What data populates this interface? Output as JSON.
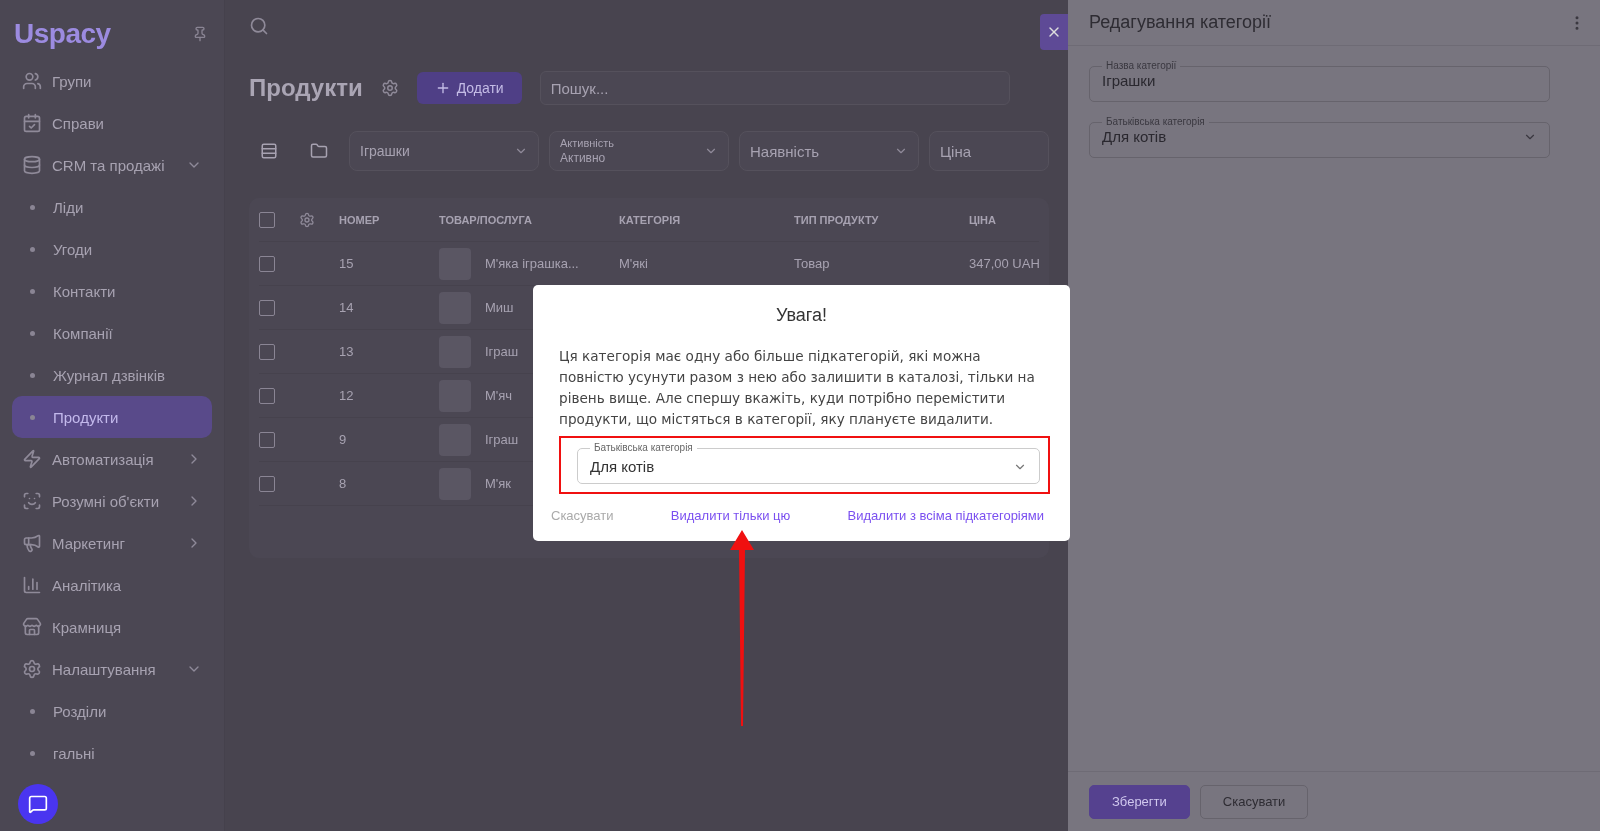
{
  "sidebar": {
    "logo": "Uspacy",
    "items": [
      {
        "kind": "section",
        "label": "Групи",
        "selected": false
      },
      {
        "kind": "section",
        "label": "Справи",
        "selected": false
      },
      {
        "kind": "group",
        "label": "CRM та продажі",
        "expanded": true,
        "selected": false
      },
      {
        "kind": "sub",
        "label": "Ліди",
        "selected": false
      },
      {
        "kind": "sub",
        "label": "Угоди",
        "selected": false
      },
      {
        "kind": "sub",
        "label": "Контакти",
        "selected": false
      },
      {
        "kind": "sub",
        "label": "Компанії",
        "selected": false
      },
      {
        "kind": "sub",
        "label": "Журнал дзвінків",
        "selected": false
      },
      {
        "kind": "sub",
        "label": "Продукти",
        "selected": true
      },
      {
        "kind": "group",
        "label": "Автоматизація",
        "expanded": false,
        "selected": false
      },
      {
        "kind": "group",
        "label": "Розумні об'єкти",
        "expanded": false,
        "selected": false
      },
      {
        "kind": "group",
        "label": "Маркетинг",
        "expanded": false,
        "selected": false
      },
      {
        "kind": "section",
        "label": "Аналітика",
        "selected": false
      },
      {
        "kind": "section",
        "label": "Крамниця",
        "selected": false
      },
      {
        "kind": "group",
        "label": "Налаштування",
        "expanded": true,
        "selected": false
      },
      {
        "kind": "sub",
        "label": "Розділи",
        "selected": false
      },
      {
        "kind": "sub",
        "label": "гальні",
        "selected": false
      }
    ]
  },
  "main": {
    "title": "Продукти",
    "add_button": "Додати",
    "search": {
      "placeholder": "Пошук..."
    },
    "filters": [
      {
        "kind": "select",
        "value": "Іграшки"
      },
      {
        "kind": "select",
        "label": "Активність",
        "value": "Активно"
      },
      {
        "kind": "select",
        "placeholder": "Наявність"
      },
      {
        "kind": "field",
        "placeholder": "Ціна"
      }
    ],
    "table": {
      "select_all_checked": false,
      "columns": [
        "НОМЕР",
        "ТОВАР/ПОСЛУГА",
        "КАТЕГОРІЯ",
        "ТИП ПРОДУКТУ",
        "ЦІНА"
      ],
      "rows": [
        {
          "checked": false,
          "number": "15",
          "name": "М'яка іграшка...",
          "category": "М'які",
          "type": "Товар",
          "price": "347,00 UAH"
        },
        {
          "checked": false,
          "number": "14",
          "name": "Миш"
        },
        {
          "checked": false,
          "number": "13",
          "name": "Іграш"
        },
        {
          "checked": false,
          "number": "12",
          "name": "М'яч"
        },
        {
          "checked": false,
          "number": "9",
          "name": "Іграш"
        },
        {
          "checked": false,
          "number": "8",
          "name": "М'як"
        }
      ]
    }
  },
  "drawer": {
    "title": "Редагування категорії",
    "fields": [
      {
        "kind": "text",
        "label": "Назва категорії",
        "value": "Іграшки"
      },
      {
        "kind": "select",
        "label": "Батьківська категорія",
        "value": "Для котів"
      }
    ],
    "buttons": [
      {
        "kind": "primary",
        "label": "Зберегти"
      },
      {
        "kind": "outline",
        "label": "Скасувати"
      }
    ]
  },
  "dialog": {
    "title": "Увага!",
    "message": "Ця категорія має одну або більше підкатегорій, які можна повністю усунути разом з нею або залишити в каталозі, тільки на рівень вище. Але спершу вкажіть, куди потрібно перемістити продукти, що містяться в категорії, яку плануєте видалити.",
    "select": {
      "label": "Батьківська категорія",
      "value": "Для котів"
    },
    "buttons": [
      {
        "kind": "muted",
        "label": "Скасувати"
      },
      {
        "kind": "primary",
        "label": "Видалити тільки цю"
      },
      {
        "kind": "primary",
        "label": "Видалити з всіма підкатегоріями"
      }
    ]
  }
}
